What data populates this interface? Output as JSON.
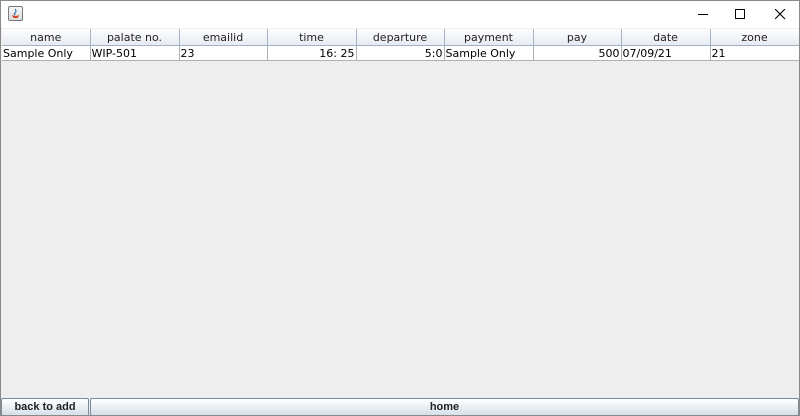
{
  "window": {
    "controls": {
      "minimize": "minimize-icon",
      "maximize": "maximize-icon",
      "close": "close-icon"
    },
    "app_icon": "java-icon"
  },
  "table": {
    "columns": [
      "name",
      "palate no.",
      "emailid",
      "time",
      "departure",
      "payment",
      "pay",
      "date",
      "zone"
    ],
    "rows": [
      [
        "Sample Only",
        "WIP-501",
        "23",
        "16: 25",
        "5:0",
        "Sample Only",
        "500",
        "07/09/21",
        "21"
      ]
    ]
  },
  "buttons": {
    "back_to_add": "back to add",
    "home": "home"
  }
}
